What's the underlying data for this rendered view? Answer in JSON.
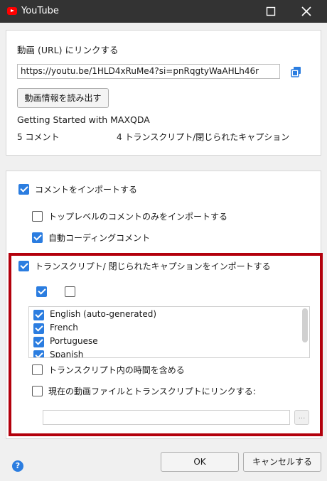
{
  "window": {
    "title": "YouTube"
  },
  "video": {
    "url_label": "動画 (URL) にリンクする",
    "url_value": "https://youtu.be/1HLD4xRuMe4?si=pnRqgtyWaAHLh46r",
    "read_button": "動画情報を読み出す",
    "title": "Getting Started with MAXQDA",
    "comments_count": "5 コメント",
    "transcripts_count": "4 トランスクリプト/閉じられたキャプション"
  },
  "options": {
    "import_comments": {
      "label": "コメントをインポートする",
      "checked": true
    },
    "top_level_only": {
      "label": "トップレベルのコメントのみをインポートする",
      "checked": false
    },
    "auto_code": {
      "label": "自動コーディングコメント",
      "checked": true
    },
    "import_transcripts": {
      "label": "トランスクリプト/ 閉じられたキャプションをインポートする",
      "checked": true
    },
    "select_all_checked": true,
    "select_none_checked": false,
    "languages": [
      {
        "name": "English (auto-generated)",
        "checked": true
      },
      {
        "name": "French",
        "checked": true
      },
      {
        "name": "Portuguese",
        "checked": true
      },
      {
        "name": "Spanish",
        "checked": true
      }
    ],
    "include_times": {
      "label": "トランスクリプト内の時間を含める",
      "checked": false
    },
    "link_media": {
      "label": "現在の動画ファイルとトランスクリプトにリンクする:",
      "checked": false
    },
    "link_path_value": "",
    "browse_label": "..."
  },
  "footer": {
    "help_icon": "?",
    "ok_label": "OK",
    "cancel_label": "キャンセルする"
  },
  "colors": {
    "accent": "#2b7de0",
    "highlight_frame": "#b3000c",
    "titlebar": "#333333"
  }
}
